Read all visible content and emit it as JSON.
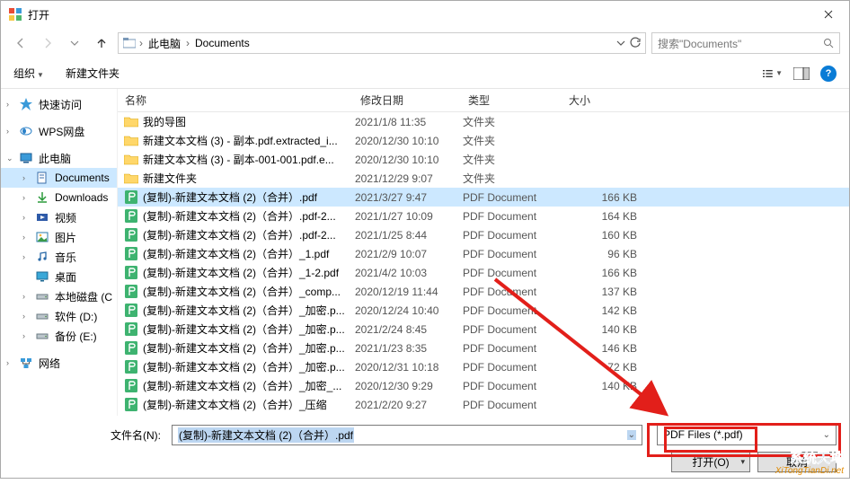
{
  "window": {
    "title": "打开"
  },
  "breadcrumb": {
    "seg1": "此电脑",
    "seg2": "Documents"
  },
  "search": {
    "placeholder": "搜索\"Documents\""
  },
  "toolbar": {
    "organize": "组织",
    "newfolder": "新建文件夹"
  },
  "columns": {
    "name": "名称",
    "date": "修改日期",
    "type": "类型",
    "size": "大小"
  },
  "sidebar": [
    {
      "label": "快速访问",
      "icon": "quickaccess",
      "chev": true
    },
    {
      "label": "WPS网盘",
      "icon": "wps",
      "chev": true,
      "gapBefore": true
    },
    {
      "label": "此电脑",
      "icon": "thispc",
      "chev": "open",
      "gapBefore": true
    },
    {
      "label": "Documents",
      "icon": "docs",
      "chev": true,
      "sub": true,
      "sel": true,
      "truncate": true
    },
    {
      "label": "Downloads",
      "icon": "downloads",
      "chev": true,
      "sub": true,
      "truncate": true
    },
    {
      "label": "视频",
      "icon": "videos",
      "chev": true,
      "sub": true
    },
    {
      "label": "图片",
      "icon": "pictures",
      "chev": true,
      "sub": true
    },
    {
      "label": "音乐",
      "icon": "music",
      "chev": true,
      "sub": true
    },
    {
      "label": "桌面",
      "icon": "desktop",
      "chev": false,
      "sub": true
    },
    {
      "label": "本地磁盘 (C",
      "icon": "drive",
      "chev": true,
      "sub": true
    },
    {
      "label": "软件 (D:)",
      "icon": "drive",
      "chev": true,
      "sub": true
    },
    {
      "label": "备份 (E:)",
      "icon": "drive",
      "chev": true,
      "sub": true
    },
    {
      "label": "网络",
      "icon": "network",
      "chev": true,
      "gapBefore": true
    }
  ],
  "files": [
    {
      "icon": "folder",
      "name": "我的导图",
      "date": "2021/1/8 11:35",
      "type": "文件夹",
      "size": ""
    },
    {
      "icon": "folder",
      "name": "新建文本文档 (3) - 副本.pdf.extracted_i...",
      "date": "2020/12/30 10:10",
      "type": "文件夹",
      "size": ""
    },
    {
      "icon": "folder",
      "name": "新建文本文档 (3) - 副本-001-001.pdf.e...",
      "date": "2020/12/30 10:10",
      "type": "文件夹",
      "size": ""
    },
    {
      "icon": "folder",
      "name": "新建文件夹",
      "date": "2021/12/29 9:07",
      "type": "文件夹",
      "size": ""
    },
    {
      "icon": "pdf",
      "name": "(复制)-新建文本文档 (2)（合并）.pdf",
      "date": "2021/3/27 9:47",
      "type": "PDF Document",
      "size": "166 KB",
      "sel": true
    },
    {
      "icon": "pdf",
      "name": "(复制)-新建文本文档 (2)（合并）.pdf-2...",
      "date": "2021/1/27 10:09",
      "type": "PDF Document",
      "size": "164 KB"
    },
    {
      "icon": "pdf",
      "name": "(复制)-新建文本文档 (2)（合并）.pdf-2...",
      "date": "2021/1/25 8:44",
      "type": "PDF Document",
      "size": "160 KB"
    },
    {
      "icon": "pdf",
      "name": "(复制)-新建文本文档 (2)（合并）_1.pdf",
      "date": "2021/2/9 10:07",
      "type": "PDF Document",
      "size": "96 KB"
    },
    {
      "icon": "pdf",
      "name": "(复制)-新建文本文档 (2)（合并）_1-2.pdf",
      "date": "2021/4/2 10:03",
      "type": "PDF Document",
      "size": "166 KB"
    },
    {
      "icon": "pdf",
      "name": "(复制)-新建文本文档 (2)（合并）_comp...",
      "date": "2020/12/19 11:44",
      "type": "PDF Document",
      "size": "137 KB"
    },
    {
      "icon": "pdf",
      "name": "(复制)-新建文本文档 (2)（合并）_加密.p...",
      "date": "2020/12/24 10:40",
      "type": "PDF Document",
      "size": "142 KB"
    },
    {
      "icon": "pdf",
      "name": "(复制)-新建文本文档 (2)（合并）_加密.p...",
      "date": "2021/2/24 8:45",
      "type": "PDF Document",
      "size": "140 KB"
    },
    {
      "icon": "pdf",
      "name": "(复制)-新建文本文档 (2)（合并）_加密.p...",
      "date": "2021/1/23 8:35",
      "type": "PDF Document",
      "size": "146 KB"
    },
    {
      "icon": "pdf",
      "name": "(复制)-新建文本文档 (2)（合并）_加密.p...",
      "date": "2020/12/31 10:18",
      "type": "PDF Document",
      "size": "72 KB"
    },
    {
      "icon": "pdf",
      "name": "(复制)-新建文本文档 (2)（合并）_加密_...",
      "date": "2020/12/30 9:29",
      "type": "PDF Document",
      "size": "140 KB"
    },
    {
      "icon": "pdf",
      "name": "(复制)-新建文本文档 (2)（合并）_压缩",
      "date": "2021/2/20 9:27",
      "type": "PDF Document",
      "size": ""
    }
  ],
  "filebox": {
    "label": "文件名(N):",
    "value": "(复制)-新建文本文档 (2)（合并）.pdf",
    "filter": "PDF Files (*.pdf)"
  },
  "buttons": {
    "open": "打开(O)",
    "cancel": "取消"
  },
  "watermark": {
    "cn": "系统天地",
    "en": "XiTongTianDi.net"
  }
}
